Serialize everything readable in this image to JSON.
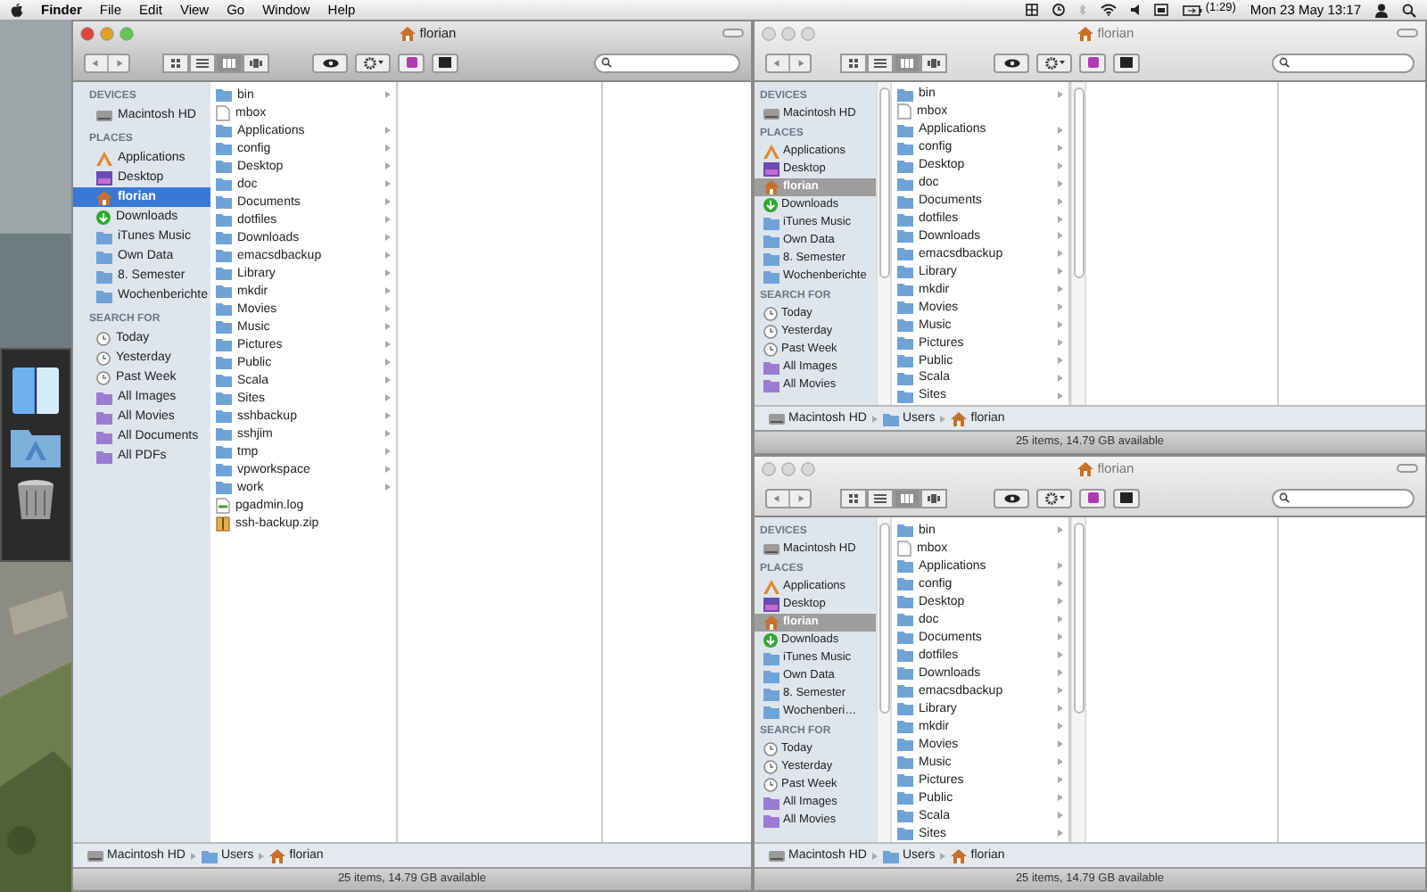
{
  "menu_bar": {
    "app": "Finder",
    "menus": [
      "File",
      "Edit",
      "View",
      "Go",
      "Window",
      "Help"
    ],
    "battery": "(1:29)",
    "clock": "Mon 23 May 13:17"
  },
  "windows": [
    {
      "title": "florian",
      "active": true,
      "view_modes": [
        {
          "selected": false
        },
        {
          "selected": false
        },
        {
          "selected": true
        },
        {
          "selected": false
        }
      ],
      "sidebar": [
        {
          "heading": "DEVICES",
          "items": [
            {
              "label": "Macintosh HD",
              "kind": "disk",
              "selected": false
            }
          ]
        },
        {
          "heading": "PLACES",
          "items": [
            {
              "label": "Applications",
              "kind": "apps",
              "selected": false
            },
            {
              "label": "Desktop",
              "kind": "desktop",
              "selected": false
            },
            {
              "label": "florian",
              "kind": "home",
              "selected": true
            },
            {
              "label": "Downloads",
              "kind": "download",
              "selected": false
            },
            {
              "label": "iTunes Music",
              "kind": "folder",
              "selected": false
            },
            {
              "label": "Own Data",
              "kind": "folder",
              "selected": false
            },
            {
              "label": "8. Semester",
              "kind": "folder",
              "selected": false
            },
            {
              "label": "Wochenberichte",
              "kind": "folder",
              "selected": false
            }
          ]
        },
        {
          "heading": "SEARCH FOR",
          "items": [
            {
              "label": "Today",
              "kind": "clock",
              "selected": false
            },
            {
              "label": "Yesterday",
              "kind": "clock",
              "selected": false
            },
            {
              "label": "Past Week",
              "kind": "clock",
              "selected": false
            },
            {
              "label": "All Images",
              "kind": "smart",
              "selected": false
            },
            {
              "label": "All Movies",
              "kind": "smart",
              "selected": false
            },
            {
              "label": "All Documents",
              "kind": "smart",
              "selected": false
            },
            {
              "label": "All PDFs",
              "kind": "smart",
              "selected": false
            }
          ]
        }
      ],
      "files": [
        {
          "name": "bin",
          "kind": "folder"
        },
        {
          "name": "mbox",
          "kind": "file"
        },
        {
          "name": "Applications",
          "kind": "folder"
        },
        {
          "name": "config",
          "kind": "folder"
        },
        {
          "name": "Desktop",
          "kind": "folder"
        },
        {
          "name": "doc",
          "kind": "folder"
        },
        {
          "name": "Documents",
          "kind": "folder"
        },
        {
          "name": "dotfiles",
          "kind": "folder"
        },
        {
          "name": "Downloads",
          "kind": "folder"
        },
        {
          "name": "emacsdbackup",
          "kind": "folder"
        },
        {
          "name": "Library",
          "kind": "folder"
        },
        {
          "name": "mkdir",
          "kind": "folder"
        },
        {
          "name": "Movies",
          "kind": "folder"
        },
        {
          "name": "Music",
          "kind": "folder"
        },
        {
          "name": "Pictures",
          "kind": "folder"
        },
        {
          "name": "Public",
          "kind": "folder"
        },
        {
          "name": "Scala",
          "kind": "folder"
        },
        {
          "name": "Sites",
          "kind": "folder"
        },
        {
          "name": "sshbackup",
          "kind": "folder"
        },
        {
          "name": "sshjim",
          "kind": "folder"
        },
        {
          "name": "tmp",
          "kind": "folder"
        },
        {
          "name": "vpworkspace",
          "kind": "folder"
        },
        {
          "name": "work",
          "kind": "folder"
        },
        {
          "name": "pgadmin.log",
          "kind": "log"
        },
        {
          "name": "ssh-backup.zip",
          "kind": "zip"
        }
      ],
      "path": [
        {
          "label": "Macintosh HD",
          "kind": "disk"
        },
        {
          "label": "Users",
          "kind": "folder"
        },
        {
          "label": "florian",
          "kind": "home"
        }
      ],
      "status": "25 items, 14.79 GB available"
    },
    {
      "title": "florian",
      "active": false,
      "view_modes": [
        {
          "selected": false
        },
        {
          "selected": false
        },
        {
          "selected": true
        },
        {
          "selected": false
        }
      ],
      "sidebar": [
        {
          "heading": "DEVICES",
          "items": [
            {
              "label": "Macintosh HD",
              "kind": "disk",
              "selected": false
            }
          ]
        },
        {
          "heading": "PLACES",
          "items": [
            {
              "label": "Applications",
              "kind": "apps",
              "selected": false
            },
            {
              "label": "Desktop",
              "kind": "desktop",
              "selected": false
            },
            {
              "label": "florian",
              "kind": "home",
              "selected": true
            },
            {
              "label": "Downloads",
              "kind": "download",
              "selected": false
            },
            {
              "label": "iTunes Music",
              "kind": "folder",
              "selected": false
            },
            {
              "label": "Own Data",
              "kind": "folder",
              "selected": false
            },
            {
              "label": "8. Semester",
              "kind": "folder",
              "selected": false
            },
            {
              "label": "Wochenberichte",
              "kind": "folder",
              "selected": false
            }
          ]
        },
        {
          "heading": "SEARCH FOR",
          "items": [
            {
              "label": "Today",
              "kind": "clock",
              "selected": false
            },
            {
              "label": "Yesterday",
              "kind": "clock",
              "selected": false
            },
            {
              "label": "Past Week",
              "kind": "clock",
              "selected": false
            },
            {
              "label": "All Images",
              "kind": "smart",
              "selected": false
            },
            {
              "label": "All Movies",
              "kind": "smart",
              "selected": false
            }
          ]
        }
      ],
      "files": [
        {
          "name": "bin",
          "kind": "folder"
        },
        {
          "name": "mbox",
          "kind": "file"
        },
        {
          "name": "Applications",
          "kind": "folder"
        },
        {
          "name": "config",
          "kind": "folder"
        },
        {
          "name": "Desktop",
          "kind": "folder"
        },
        {
          "name": "doc",
          "kind": "folder"
        },
        {
          "name": "Documents",
          "kind": "folder"
        },
        {
          "name": "dotfiles",
          "kind": "folder"
        },
        {
          "name": "Downloads",
          "kind": "folder"
        },
        {
          "name": "emacsdbackup",
          "kind": "folder"
        },
        {
          "name": "Library",
          "kind": "folder"
        },
        {
          "name": "mkdir",
          "kind": "folder"
        },
        {
          "name": "Movies",
          "kind": "folder"
        },
        {
          "name": "Music",
          "kind": "folder"
        },
        {
          "name": "Pictures",
          "kind": "folder"
        },
        {
          "name": "Public",
          "kind": "folder"
        },
        {
          "name": "Scala",
          "kind": "folder"
        },
        {
          "name": "Sites",
          "kind": "folder"
        }
      ],
      "path": [
        {
          "label": "Macintosh HD",
          "kind": "disk"
        },
        {
          "label": "Users",
          "kind": "folder"
        },
        {
          "label": "florian",
          "kind": "home"
        }
      ],
      "status": "25 items, 14.79 GB available"
    },
    {
      "title": "florian",
      "active": false,
      "view_modes": [
        {
          "selected": false
        },
        {
          "selected": false
        },
        {
          "selected": true
        },
        {
          "selected": false
        }
      ],
      "sidebar": [
        {
          "heading": "DEVICES",
          "items": [
            {
              "label": "Macintosh HD",
              "kind": "disk",
              "selected": false
            }
          ]
        },
        {
          "heading": "PLACES",
          "items": [
            {
              "label": "Applications",
              "kind": "apps",
              "selected": false
            },
            {
              "label": "Desktop",
              "kind": "desktop",
              "selected": false
            },
            {
              "label": "florian",
              "kind": "home",
              "selected": true
            },
            {
              "label": "Downloads",
              "kind": "download",
              "selected": false
            },
            {
              "label": "iTunes Music",
              "kind": "folder",
              "selected": false
            },
            {
              "label": "Own Data",
              "kind": "folder",
              "selected": false
            },
            {
              "label": "8. Semester",
              "kind": "folder",
              "selected": false
            },
            {
              "label": "Wochenberi…",
              "kind": "folder",
              "selected": false
            }
          ]
        },
        {
          "heading": "SEARCH FOR",
          "items": [
            {
              "label": "Today",
              "kind": "clock",
              "selected": false
            },
            {
              "label": "Yesterday",
              "kind": "clock",
              "selected": false
            },
            {
              "label": "Past Week",
              "kind": "clock",
              "selected": false
            },
            {
              "label": "All Images",
              "kind": "smart",
              "selected": false
            },
            {
              "label": "All Movies",
              "kind": "smart",
              "selected": false
            }
          ]
        }
      ],
      "files": [
        {
          "name": "bin",
          "kind": "folder"
        },
        {
          "name": "mbox",
          "kind": "file"
        },
        {
          "name": "Applications",
          "kind": "folder"
        },
        {
          "name": "config",
          "kind": "folder"
        },
        {
          "name": "Desktop",
          "kind": "folder"
        },
        {
          "name": "doc",
          "kind": "folder"
        },
        {
          "name": "Documents",
          "kind": "folder"
        },
        {
          "name": "dotfiles",
          "kind": "folder"
        },
        {
          "name": "Downloads",
          "kind": "folder"
        },
        {
          "name": "emacsdbackup",
          "kind": "folder"
        },
        {
          "name": "Library",
          "kind": "folder"
        },
        {
          "name": "mkdir",
          "kind": "folder"
        },
        {
          "name": "Movies",
          "kind": "folder"
        },
        {
          "name": "Music",
          "kind": "folder"
        },
        {
          "name": "Pictures",
          "kind": "folder"
        },
        {
          "name": "Public",
          "kind": "folder"
        },
        {
          "name": "Scala",
          "kind": "folder"
        },
        {
          "name": "Sites",
          "kind": "folder"
        }
      ],
      "path": [
        {
          "label": "Macintosh HD",
          "kind": "disk"
        },
        {
          "label": "Users",
          "kind": "folder"
        },
        {
          "label": "florian",
          "kind": "home"
        }
      ],
      "status": "25 items, 14.79 GB available"
    }
  ]
}
